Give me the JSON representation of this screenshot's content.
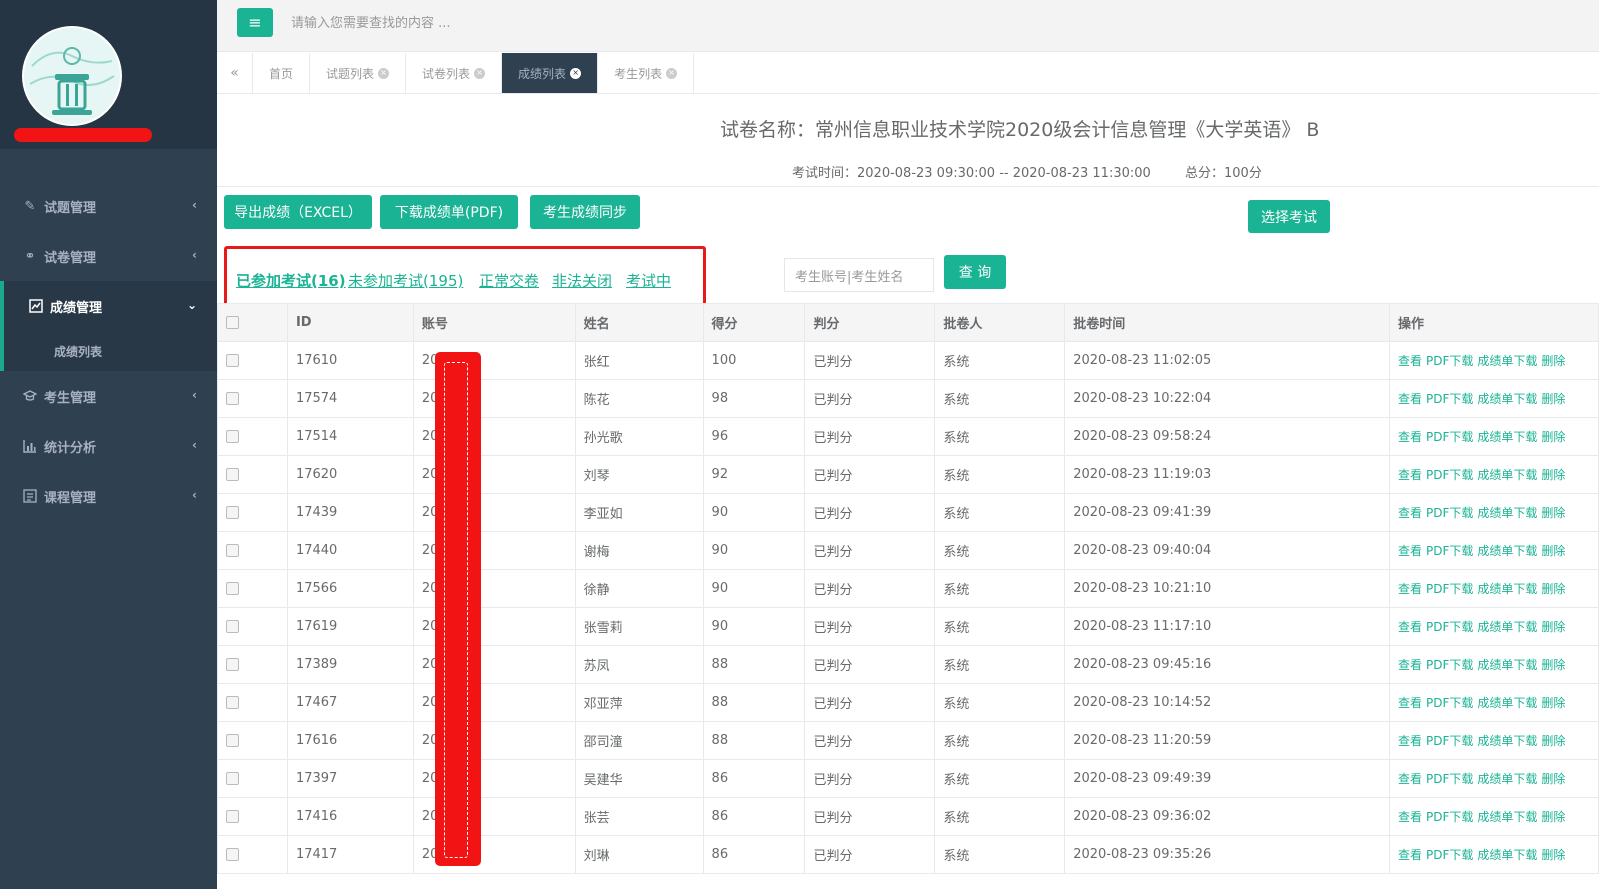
{
  "topbar": {
    "search_placeholder": "请输入您需要查找的内容 ..."
  },
  "sidebar": {
    "items": [
      {
        "label": "试题管理",
        "icon": "edit-icon"
      },
      {
        "label": "试卷管理",
        "icon": "link-icon"
      },
      {
        "label": "成绩管理",
        "icon": "chart-icon"
      },
      {
        "label": "考生管理",
        "icon": "graduation-cap-icon"
      },
      {
        "label": "统计分析",
        "icon": "bar-chart-icon"
      },
      {
        "label": "课程管理",
        "icon": "list-icon"
      }
    ],
    "sub_item": "成绩列表"
  },
  "tabs": [
    {
      "label": "首页"
    },
    {
      "label": "试题列表"
    },
    {
      "label": "试卷列表"
    },
    {
      "label": "成绩列表"
    },
    {
      "label": "考生列表"
    }
  ],
  "header": {
    "paper_title": "试卷名称：常州信息职业技术学院2020级会计信息管理《大学英语》 B",
    "exam_time": "考试时间：2020-08-23 09:30:00 -- 2020-08-23 11:30:00",
    "total_score": "总分：100分"
  },
  "actions": {
    "export_excel": "导出成绩（EXCEL）",
    "download_pdf": "下载成绩单(PDF)",
    "sync_scores": "考生成绩同步",
    "select_exam": "选择考试"
  },
  "filters": {
    "attended": "已参加考试(16)",
    "not_attended": "未参加考试(195)",
    "normal_submit": "正常交卷",
    "illegal_close": "非法关闭",
    "in_progress": "考试中"
  },
  "search": {
    "placeholder": "考生账号|考生姓名",
    "button": "查 询"
  },
  "table": {
    "headers": [
      "ID",
      "账号",
      "姓名",
      "得分",
      "判分",
      "批卷人",
      "批卷时间",
      "操作"
    ],
    "ops": [
      "查看",
      "PDF下载",
      "成绩单下载",
      "删除"
    ],
    "rows": [
      {
        "id": "17610",
        "account": "20",
        "name": "张红",
        "score": "100",
        "status": "已判分",
        "grader": "系统",
        "time": "2020-08-23 11:02:05"
      },
      {
        "id": "17574",
        "account": "20",
        "name": "陈花",
        "score": "98",
        "status": "已判分",
        "grader": "系统",
        "time": "2020-08-23 10:22:04"
      },
      {
        "id": "17514",
        "account": "20",
        "name": "孙光歌",
        "score": "96",
        "status": "已判分",
        "grader": "系统",
        "time": "2020-08-23 09:58:24"
      },
      {
        "id": "17620",
        "account": "20",
        "name": "刘琴",
        "score": "92",
        "status": "已判分",
        "grader": "系统",
        "time": "2020-08-23 11:19:03"
      },
      {
        "id": "17439",
        "account": "20",
        "name": "李亚如",
        "score": "90",
        "status": "已判分",
        "grader": "系统",
        "time": "2020-08-23 09:41:39"
      },
      {
        "id": "17440",
        "account": "20",
        "name": "谢梅",
        "score": "90",
        "status": "已判分",
        "grader": "系统",
        "time": "2020-08-23 09:40:04"
      },
      {
        "id": "17566",
        "account": "20",
        "name": "徐静",
        "score": "90",
        "status": "已判分",
        "grader": "系统",
        "time": "2020-08-23 10:21:10"
      },
      {
        "id": "17619",
        "account": "20",
        "name": "张雪莉",
        "score": "90",
        "status": "已判分",
        "grader": "系统",
        "time": "2020-08-23 11:17:10"
      },
      {
        "id": "17389",
        "account": "20",
        "name": "苏凤",
        "score": "88",
        "status": "已判分",
        "grader": "系统",
        "time": "2020-08-23 09:45:16"
      },
      {
        "id": "17467",
        "account": "20",
        "name": "邓亚萍",
        "score": "88",
        "status": "已判分",
        "grader": "系统",
        "time": "2020-08-23 10:14:52"
      },
      {
        "id": "17616",
        "account": "20",
        "name": "邵司潼",
        "score": "88",
        "status": "已判分",
        "grader": "系统",
        "time": "2020-08-23 11:20:59"
      },
      {
        "id": "17397",
        "account": "20",
        "name": "吴建华",
        "score": "86",
        "status": "已判分",
        "grader": "系统",
        "time": "2020-08-23 09:49:39"
      },
      {
        "id": "17416",
        "account": "20",
        "name": "张芸",
        "score": "86",
        "status": "已判分",
        "grader": "系统",
        "time": "2020-08-23 09:36:02"
      },
      {
        "id": "17417",
        "account": "20",
        "name": "刘琳",
        "score": "86",
        "status": "已判分",
        "grader": "系统",
        "time": "2020-08-23 09:35:26"
      }
    ]
  },
  "colors": {
    "sidebar": "#2f4050",
    "accent": "#1ab394",
    "annotation_red": "#e8191b"
  }
}
